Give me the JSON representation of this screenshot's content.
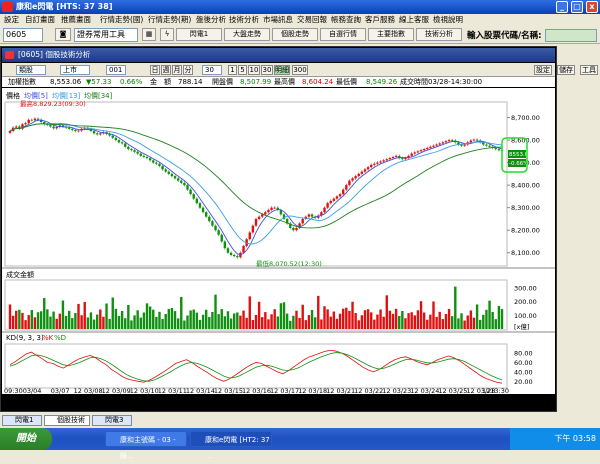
{
  "window": {
    "title": "康和e閃電 [HTS: 37 38]",
    "minimize": "_",
    "maximize": "□",
    "close": "x"
  },
  "menu": [
    "設定",
    "自訂畫面",
    "推薦畫面",
    "行情走勢(國)",
    "行情走勢(期)",
    "盤後分析",
    "技術分析",
    "市場訊息",
    "交易回報",
    "帳務查詢",
    "客戶服務",
    "線上客服",
    "檢視說明"
  ],
  "toolbar": {
    "stock_code": "0605",
    "tool_select": "證券常用工具",
    "buttons": [
      "閃電1",
      "大盤走勢",
      "個股走勢",
      "自選行情",
      "主要指數",
      "技術分析"
    ],
    "search_label": "輸入股票代碼/名稱:",
    "search_value": ""
  },
  "panel": {
    "title": "[0605] 個股技術分析",
    "right_buttons": [
      "設定",
      "儲存",
      "工具"
    ],
    "options": {
      "period": "類股",
      "market": "上市",
      "code": "001",
      "freq_day": "日",
      "freq_week": "週",
      "freq_month": "月",
      "freq_min": "分",
      "minutes": "30",
      "min_buttons": [
        "1",
        "5",
        "10",
        "30"
      ],
      "selected_min": "明細",
      "count": "300"
    },
    "info": {
      "name": "加權指數",
      "price": "8,553.06",
      "change": "▼57.33",
      "pct": "0.66%",
      "amount_label": "金",
      "amount_unit": "額",
      "amount": "788.14",
      "open_label": "開盤價",
      "open": "8,507.99",
      "high_label": "最高價",
      "high": "8,604.24",
      "low_label": "最低價",
      "low": "8,549.26",
      "time_label": "成交時間",
      "time": "03/28-14:30:00"
    }
  },
  "chart_data": [
    {
      "type": "candlestick",
      "title": "價格",
      "legend": [
        "均價[5]",
        "均價[13]",
        "均價[34]"
      ],
      "colors": {
        "up": "#e01010",
        "down": "#109010",
        "ma5": "#4050e0",
        "ma13": "#3aa0e0",
        "ma34": "#208020"
      },
      "y_ticks": [
        "8,700.00",
        "8,600.00",
        "8,500.00",
        "8,400.00",
        "8,300.00",
        "8,200.00",
        "8,100.00"
      ],
      "ylim": [
        8050,
        8760
      ],
      "annotations": [
        {
          "text": "最高8,829.23(09:30)",
          "x_index": 9,
          "y": 8695
        },
        {
          "text": "最低8,070.52(12:30)",
          "x_index": 82,
          "y": 8075
        }
      ],
      "current_value": "8553.06",
      "current_change": "-0.66%",
      "close": [
        8640,
        8655,
        8660,
        8650,
        8670,
        8675,
        8690,
        8688,
        8695,
        8690,
        8680,
        8670,
        8668,
        8660,
        8652,
        8658,
        8665,
        8660,
        8655,
        8650,
        8645,
        8640,
        8642,
        8650,
        8655,
        8650,
        8640,
        8630,
        8625,
        8630,
        8635,
        8628,
        8620,
        8610,
        8600,
        8590,
        8585,
        8570,
        8560,
        8555,
        8548,
        8540,
        8530,
        8525,
        8520,
        8510,
        8500,
        8495,
        8485,
        8470,
        8460,
        8450,
        8440,
        8430,
        8420,
        8410,
        8400,
        8380,
        8360,
        8340,
        8320,
        8300,
        8280,
        8260,
        8240,
        8220,
        8200,
        8180,
        8150,
        8120,
        8100,
        8090,
        8085,
        8080,
        8100,
        8130,
        8160,
        8190,
        8220,
        8250,
        8260,
        8270,
        8280,
        8290,
        8300,
        8300,
        8290,
        8270,
        8250,
        8230,
        8210,
        8200,
        8210,
        8230,
        8250,
        8260,
        8270,
        8260,
        8255,
        8265,
        8280,
        8300,
        8320,
        8330,
        8340,
        8350,
        8360,
        8380,
        8400,
        8420,
        8430,
        8440,
        8450,
        8460,
        8470,
        8480,
        8490,
        8495,
        8500,
        8505,
        8510,
        8515,
        8520,
        8525,
        8530,
        8520,
        8515,
        8520,
        8530,
        8540,
        8545,
        8550,
        8555,
        8560,
        8565,
        8570,
        8575,
        8580,
        8585,
        8590,
        8595,
        8600,
        8598,
        8590,
        8580,
        8575,
        8580,
        8590,
        8598,
        8602,
        8598,
        8590,
        8580,
        8575,
        8570,
        8565,
        8560,
        8555,
        8553
      ]
    },
    {
      "type": "bar",
      "title": "成交金額",
      "y_ticks": [
        "300.00",
        "200.00",
        "100.00"
      ],
      "unit": "[x億]",
      "ylim": [
        0,
        330
      ]
    },
    {
      "type": "line",
      "title": "KD(9, 3, 3)",
      "legend": [
        "%K",
        "%D"
      ],
      "y_ticks": [
        "80.00",
        "60.00",
        "40.00",
        "20.00"
      ],
      "ylim": [
        10,
        95
      ],
      "k": [
        55,
        62,
        70,
        78,
        82,
        75,
        68,
        60,
        58,
        52,
        48,
        55,
        62,
        68,
        72,
        75,
        70,
        62,
        55,
        45,
        38,
        30,
        25,
        22,
        20,
        18,
        22,
        28,
        35,
        42,
        50,
        58,
        62,
        66,
        60,
        52,
        45,
        38,
        30,
        24,
        20,
        25,
        32,
        40,
        48,
        55,
        60,
        58,
        52,
        46,
        40,
        36,
        42,
        50,
        58,
        66,
        72,
        76,
        80,
        84,
        86,
        84,
        80,
        74,
        66,
        58,
        50,
        44,
        40,
        45,
        52,
        60,
        66,
        70,
        72,
        68,
        62,
        58,
        55,
        60,
        66,
        70,
        74,
        70,
        64,
        56,
        48,
        40,
        32,
        26,
        22,
        18,
        16
      ],
      "d": [
        52,
        56,
        62,
        68,
        74,
        76,
        74,
        70,
        65,
        60,
        55,
        53,
        56,
        60,
        65,
        70,
        71,
        68,
        63,
        56,
        48,
        40,
        33,
        28,
        24,
        21,
        20,
        23,
        28,
        34,
        40,
        47,
        53,
        58,
        60,
        58,
        54,
        49,
        43,
        37,
        31,
        27,
        28,
        32,
        38,
        44,
        50,
        53,
        54,
        52,
        48,
        44,
        43,
        45,
        49,
        55,
        61,
        66,
        71,
        75,
        79,
        81,
        80,
        77,
        72,
        66,
        60,
        54,
        49,
        46,
        48,
        52,
        57,
        62,
        66,
        67,
        65,
        62,
        59,
        59,
        61,
        64,
        67,
        68,
        66,
        62,
        56,
        50,
        44,
        38,
        32,
        27,
        23
      ]
    },
    {
      "type": "axis",
      "x_labels": [
        "09:30",
        "03/04",
        "03/07",
        "12 03/08",
        "12 03/09",
        "12 03/10",
        "12 03/11",
        "12 03/14",
        "12 03/15",
        "12 03/16",
        "12 03/17",
        "12 03/18",
        "12 03/21",
        "12 03/22",
        "12 03/23",
        "12 03/24",
        "12 03/25",
        "12 03/28",
        "1213:30"
      ]
    }
  ],
  "bottom_tabs": [
    "閃電1",
    "個股技術",
    "閃電3"
  ],
  "taskbar": {
    "start": "開始",
    "items": [
      "康和主號碼 - 03 - 錄...",
      "康和e閃電 [HT2: 37 ..."
    ],
    "clock": "下午 03:58"
  }
}
